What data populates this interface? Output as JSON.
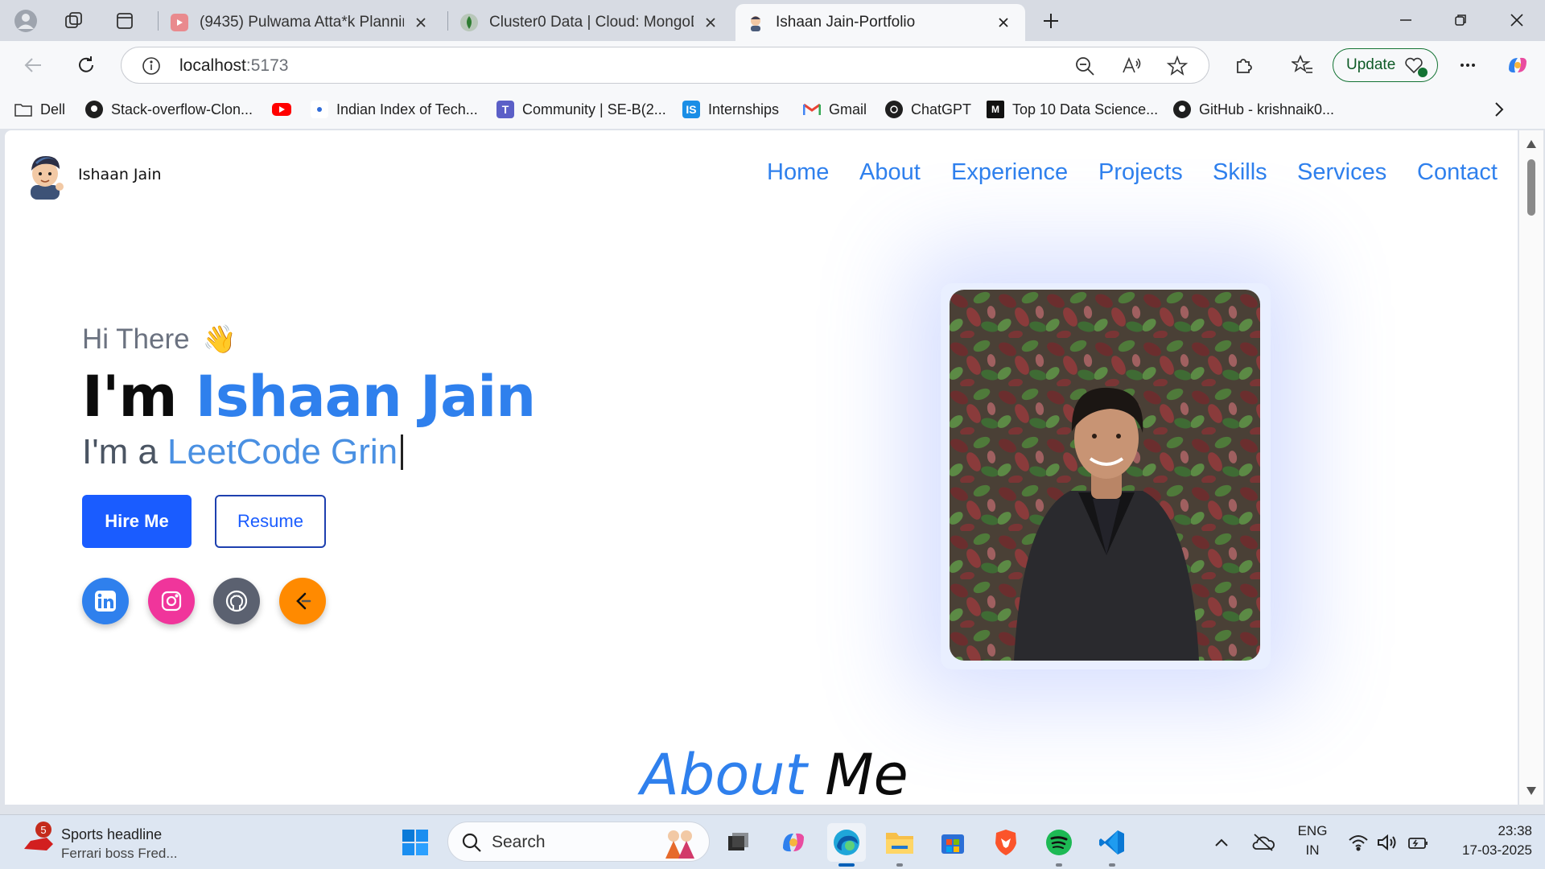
{
  "browser": {
    "tabs": [
      {
        "title": "(9435) Pulwama Atta*k Planning -",
        "favicon": "youtube-icon"
      },
      {
        "title": "Cluster0 Data | Cloud: MongoDB C",
        "favicon": "mongodb-icon"
      },
      {
        "title": "Ishaan Jain-Portfolio",
        "favicon": "portfolio-avatar-icon",
        "active": true
      }
    ],
    "address": {
      "host": "localhost",
      "port": ":5173"
    },
    "update_label": "Update",
    "favorites": [
      {
        "label": "Dell",
        "icon": "folder-icon"
      },
      {
        "label": "Stack-overflow-Clon...",
        "icon": "github-icon"
      },
      {
        "label": "",
        "icon": "youtube-icon"
      },
      {
        "label": "Indian Index of Tech...",
        "icon": "site-icon"
      },
      {
        "label": "Community | SE-B(2...",
        "icon": "teams-icon"
      },
      {
        "label": "Internships",
        "icon": "internshala-icon"
      },
      {
        "label": "Gmail",
        "icon": "gmail-icon"
      },
      {
        "label": "ChatGPT",
        "icon": "chatgpt-icon"
      },
      {
        "label": "Top 10 Data Science...",
        "icon": "medium-icon"
      },
      {
        "label": "GitHub - krishnaik0...",
        "icon": "github-icon"
      }
    ]
  },
  "site": {
    "brand": "Ishaan Jain",
    "nav": [
      "Home",
      "About",
      "Experience",
      "Projects",
      "Skills",
      "Services",
      "Contact"
    ],
    "hero": {
      "greeting": "Hi There",
      "wave": "👋",
      "im_prefix": "I'm",
      "name": "Ishaan Jain",
      "role_prefix": "I'm a",
      "role_typed": "LeetCode Grin",
      "hire_label": "Hire Me",
      "resume_label": "Resume"
    },
    "socials": [
      {
        "name": "linkedin",
        "color": "#2f80ed"
      },
      {
        "name": "instagram",
        "color": "#f0359b"
      },
      {
        "name": "github",
        "color": "#5b6170"
      },
      {
        "name": "leetcode",
        "color": "#ff8a00"
      }
    ],
    "about": {
      "part1": "About",
      "part2": "Me"
    }
  },
  "taskbar": {
    "news_badge": "5",
    "news_title": "Sports headline",
    "news_sub": "Ferrari boss Fred...",
    "search_label": "Search",
    "lang_top": "ENG",
    "lang_bottom": "IN",
    "time": "23:38",
    "date": "17-03-2025"
  },
  "colors": {
    "accent": "#2f80ed",
    "hire": "#1a5cff",
    "edge_update": "#137333"
  }
}
